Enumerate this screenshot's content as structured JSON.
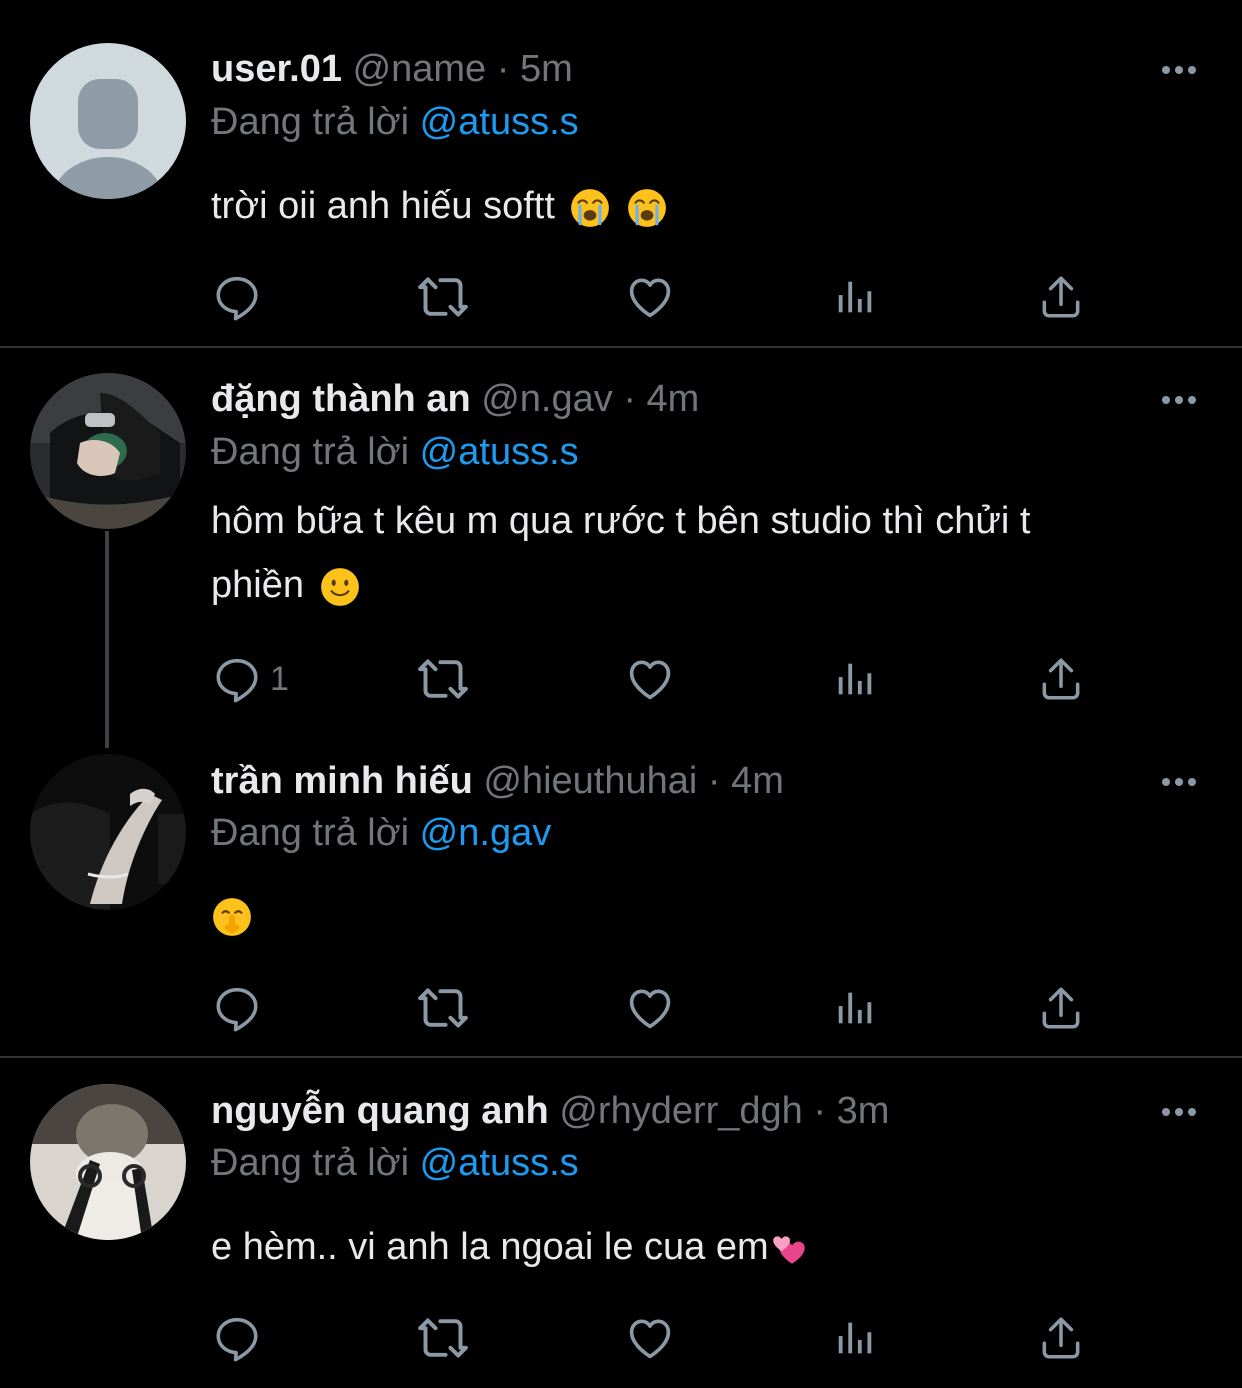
{
  "tweets": [
    {
      "display_name": "user.01",
      "handle": "@name",
      "separator": "·",
      "time": "5m",
      "replying_label": "Đang trả lời",
      "replying_to": "@atuss.s",
      "text": "trời oii anh hiếu softt",
      "reply_count": ""
    },
    {
      "display_name": "đặng thành an",
      "handle": "@n.gav",
      "separator": "·",
      "time": "4m",
      "replying_label": "Đang trả lời",
      "replying_to": "@atuss.s",
      "text_line1": "hôm bữa t kêu m qua rước t bên studio thì chửi t",
      "text_line2": "phiền",
      "reply_count": "1"
    },
    {
      "display_name": "trần minh hiếu",
      "handle": "@hieuthuhai",
      "separator": "·",
      "time": "4m",
      "replying_label": "Đang trả lời",
      "replying_to": "@n.gav",
      "text": "",
      "reply_count": ""
    },
    {
      "display_name": "nguyễn quang anh",
      "handle": "@rhyderr_dgh",
      "separator": "·",
      "time": "3m",
      "replying_label": "Đang trả lời",
      "replying_to": "@atuss.s",
      "text": "e hèm.. vi anh la ngoai le cua em",
      "reply_count": ""
    }
  ],
  "colors": {
    "background": "#000000",
    "text": "#e7e9ea",
    "muted": "#71767b",
    "accent": "#1d9bf0",
    "divider": "#2f3336"
  },
  "icons": {
    "actions": [
      "reply-icon",
      "retweet-icon",
      "like-icon",
      "views-icon",
      "share-icon"
    ],
    "more": "more-icon"
  }
}
